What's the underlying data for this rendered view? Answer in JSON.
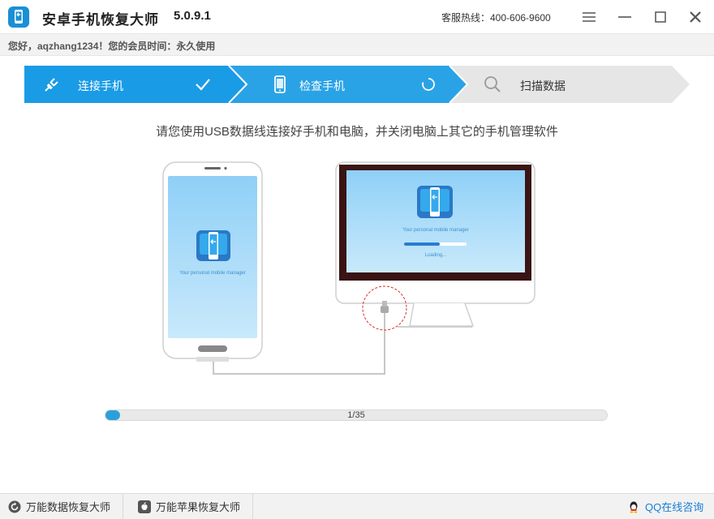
{
  "titlebar": {
    "title": "安卓手机恢复大师",
    "version": "5.0.9.1",
    "hotline": "客服热线：400-606-9600"
  },
  "greeting": "您好，aqzhang1234！您的会员时间：永久使用",
  "steps": [
    {
      "label": "连接手机",
      "state": "done"
    },
    {
      "label": "检查手机",
      "state": "loading"
    },
    {
      "label": "扫描数据",
      "state": "pending"
    }
  ],
  "instruction": "请您使用USB数据线连接好手机和电脑，并关闭电脑上其它的手机管理软件",
  "illustration": {
    "phone_tagline": "Your personal mobile manager",
    "monitor_tagline": "Your personal mobile manager",
    "monitor_status": "Loading..."
  },
  "progress": {
    "current": 1,
    "total": 35,
    "text": "1/35"
  },
  "bottombar": {
    "link1": "万能数据恢复大师",
    "link2": "万能苹果恢复大师",
    "qq": "QQ在线咨询"
  },
  "colors": {
    "accent": "#1a9be6",
    "step_active": "#2aa3e6",
    "step_inactive": "#e6e6e6",
    "progress": "#2aa0db",
    "link": "#1a7ed6"
  }
}
